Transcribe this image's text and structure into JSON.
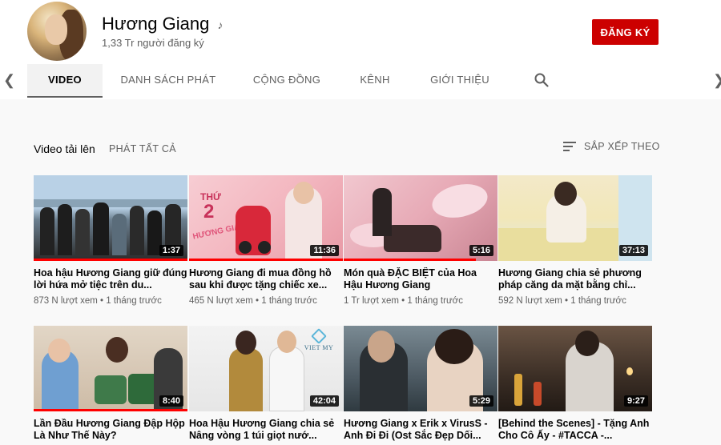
{
  "channel": {
    "name": "Hương Giang",
    "subscribers": "1,33 Tr người đăng ký",
    "subscribe_label": "ĐĂNG KÝ",
    "verified_icon": "music-note-icon"
  },
  "tabs": [
    {
      "label": "VIDEO",
      "active": true
    },
    {
      "label": "DANH SÁCH PHÁT",
      "active": false
    },
    {
      "label": "CỘNG ĐỒNG",
      "active": false
    },
    {
      "label": "KÊNH",
      "active": false
    },
    {
      "label": "GIỚI THIỆU",
      "active": false
    }
  ],
  "section": {
    "title": "Video tải lên",
    "play_all": "PHÁT TẤT CẢ",
    "sort_label": "SẮP XẾP THEO"
  },
  "videos": [
    {
      "title": "Hoa hậu Hương Giang giữ đúng lời hứa mở tiệc trên du...",
      "views": "873 N lượt xem",
      "age": "1 tháng trước",
      "duration": "1:37",
      "watched": 1.0
    },
    {
      "title": "Hương Giang đi mua đồng hồ sau khi được tặng chiếc xe...",
      "views": "465 N lượt xem",
      "age": "1 tháng trước",
      "duration": "11:36",
      "watched": 1.0,
      "thumb_text": {
        "line1": "THỨ",
        "line2": "2",
        "line3": "HƯƠNG GIANG"
      }
    },
    {
      "title": "Món quà ĐẶC BIỆT của Hoa Hậu Hương Giang",
      "views": "1 Tr lượt xem",
      "age": "1 tháng trước",
      "duration": "5:16",
      "watched": 0.86
    },
    {
      "title": "Hương Giang chia sẻ phương pháp căng da mặt bằng chỉ...",
      "views": "592 N lượt xem",
      "age": "1 tháng trước",
      "duration": "37:13",
      "watched": 0
    },
    {
      "title": "Lần Đầu Hương Giang Đập Hộp Là Như Thế Này?",
      "views": "",
      "age": "",
      "duration": "8:40",
      "watched": 1.0
    },
    {
      "title": "Hoa Hậu Hương Giang chia sẻ Nâng vòng 1 túi giọt nướ...",
      "views": "",
      "age": "",
      "duration": "42:04",
      "watched": 0,
      "thumb_text": {
        "brand": "VIET MY"
      }
    },
    {
      "title": "Hương Giang x Erik x VirusS - Anh Đi Đi (Ost Sắc Đẹp Dối...",
      "views": "",
      "age": "",
      "duration": "5:29",
      "watched": 0
    },
    {
      "title": "[Behind the Scenes] - Tặng Anh Cho Cô Ấy - #TACCA -...",
      "views": "",
      "age": "",
      "duration": "9:27",
      "watched": 0
    }
  ],
  "meta_separator": "•",
  "colors": {
    "brand_red": "#cc0000",
    "progress_red": "#ff0000",
    "text_secondary": "#606060"
  }
}
